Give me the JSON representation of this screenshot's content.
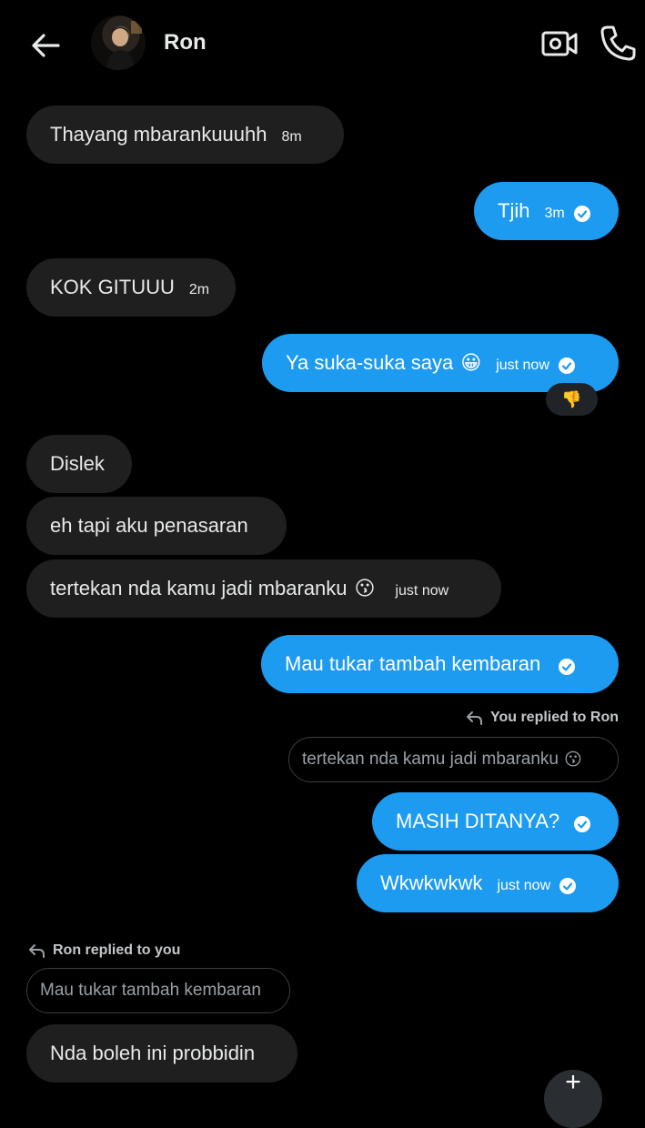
{
  "header": {
    "contact_name": "Ron",
    "back_icon": "arrow-left-icon",
    "video_icon": "video-call-icon",
    "call_icon": "phone-icon"
  },
  "messages": [
    {
      "side": "in",
      "text": "Thayang mbarankuuuhh",
      "time": "8m"
    },
    {
      "side": "out",
      "text": "Tjih",
      "time": "3m",
      "read": true
    },
    {
      "side": "in",
      "text": "KOK GITUUU",
      "time": "2m"
    },
    {
      "side": "out",
      "text": "Ya suka-suka saya",
      "emoji": "😀",
      "time": "just now",
      "read": true,
      "reaction": "👎"
    },
    {
      "side": "in",
      "text": "Dislek"
    },
    {
      "side": "in",
      "text": "eh tapi aku penasaran"
    },
    {
      "side": "in",
      "text": "tertekan nda kamu jadi mbaranku",
      "emoji": "😗",
      "time": "just now"
    },
    {
      "side": "out",
      "text": "Mau tukar tambah kembaran",
      "read": true
    },
    {
      "side": "out",
      "reply_note": "You replied to Ron",
      "quote": "tertekan nda kamu jadi mbaranku",
      "quote_emoji": "😗",
      "text": "MASIH DITANYA?",
      "read": true
    },
    {
      "side": "out",
      "text": "Wkwkwkwk",
      "time": "just now",
      "read": true
    },
    {
      "side": "in",
      "reply_note": "Ron replied to you",
      "quote": "Mau tukar tambah kembaran",
      "text": "Nda boleh ini probbidin"
    }
  ],
  "colors": {
    "background": "#000000",
    "incoming_bubble": "#1f1f1f",
    "outgoing_bubble": "#1d9bf0",
    "text": "#e7e9ea"
  }
}
